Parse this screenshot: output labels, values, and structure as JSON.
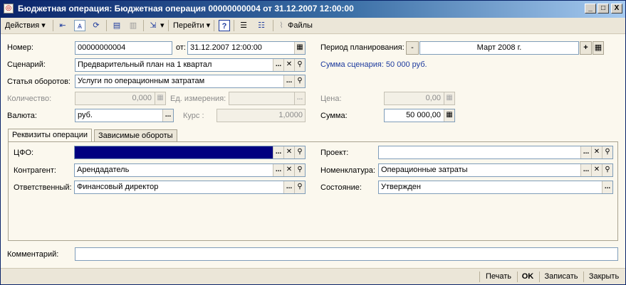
{
  "window": {
    "title": "Бюджетная операция: Бюджетная операция 00000000004 от 31.12.2007 12:00:00",
    "controls": {
      "minimize": "_",
      "maximize": "□",
      "close": "X"
    }
  },
  "toolbar": {
    "actions_label": "Действия",
    "goto_label": "Перейти",
    "files_label": "Файлы",
    "help_label": "?"
  },
  "form": {
    "number_label": "Номер:",
    "number_value": "00000000004",
    "date_label": "от:",
    "date_value": "31.12.2007 12:00:00",
    "period_label": "Период планирования:",
    "period_value": "Март 2008 г.",
    "period_minus": "-",
    "period_plus": "+",
    "scenario_label": "Сценарий:",
    "scenario_value": "Предварительный план на 1 квартал",
    "scenario_sum": "Сумма сценария: 50 000 руб.",
    "article_label": "Статья оборотов:",
    "article_value": "Услуги по операционным затратам",
    "quantity_label": "Количество:",
    "quantity_value": "0,000",
    "unit_label": "Ед. измерения:",
    "unit_value": "",
    "price_label": "Цена:",
    "price_value": "0,00",
    "currency_label": "Валюта:",
    "currency_value": "руб.",
    "rate_label": "Курс :",
    "rate_value": "1,0000",
    "sum_label": "Сумма:",
    "sum_value": "50 000,00"
  },
  "tabs": [
    {
      "label": "Реквизиты операции"
    },
    {
      "label": "Зависимые обороты"
    }
  ],
  "details": {
    "cfo_label": "ЦФО:",
    "cfo_value": "",
    "project_label": "Проект:",
    "project_value": "",
    "counterparty_label": "Контрагент:",
    "counterparty_value": "Арендадатель",
    "nomenclature_label": "Номенклатура:",
    "nomenclature_value": "Операционные затраты",
    "responsible_label": "Ответственный:",
    "responsible_value": "Финансовый директор",
    "state_label": "Состояние:",
    "state_value": "Утвержден"
  },
  "comment": {
    "label": "Комментарий:",
    "value": ""
  },
  "bottom": {
    "print_label": "Печать",
    "ok_label": "OK",
    "save_label": "Записать",
    "close_label": "Закрыть"
  },
  "icons": {
    "select": "...",
    "clear": "✕",
    "search": "⚲",
    "calendar": "▦",
    "calculator": "▦"
  }
}
